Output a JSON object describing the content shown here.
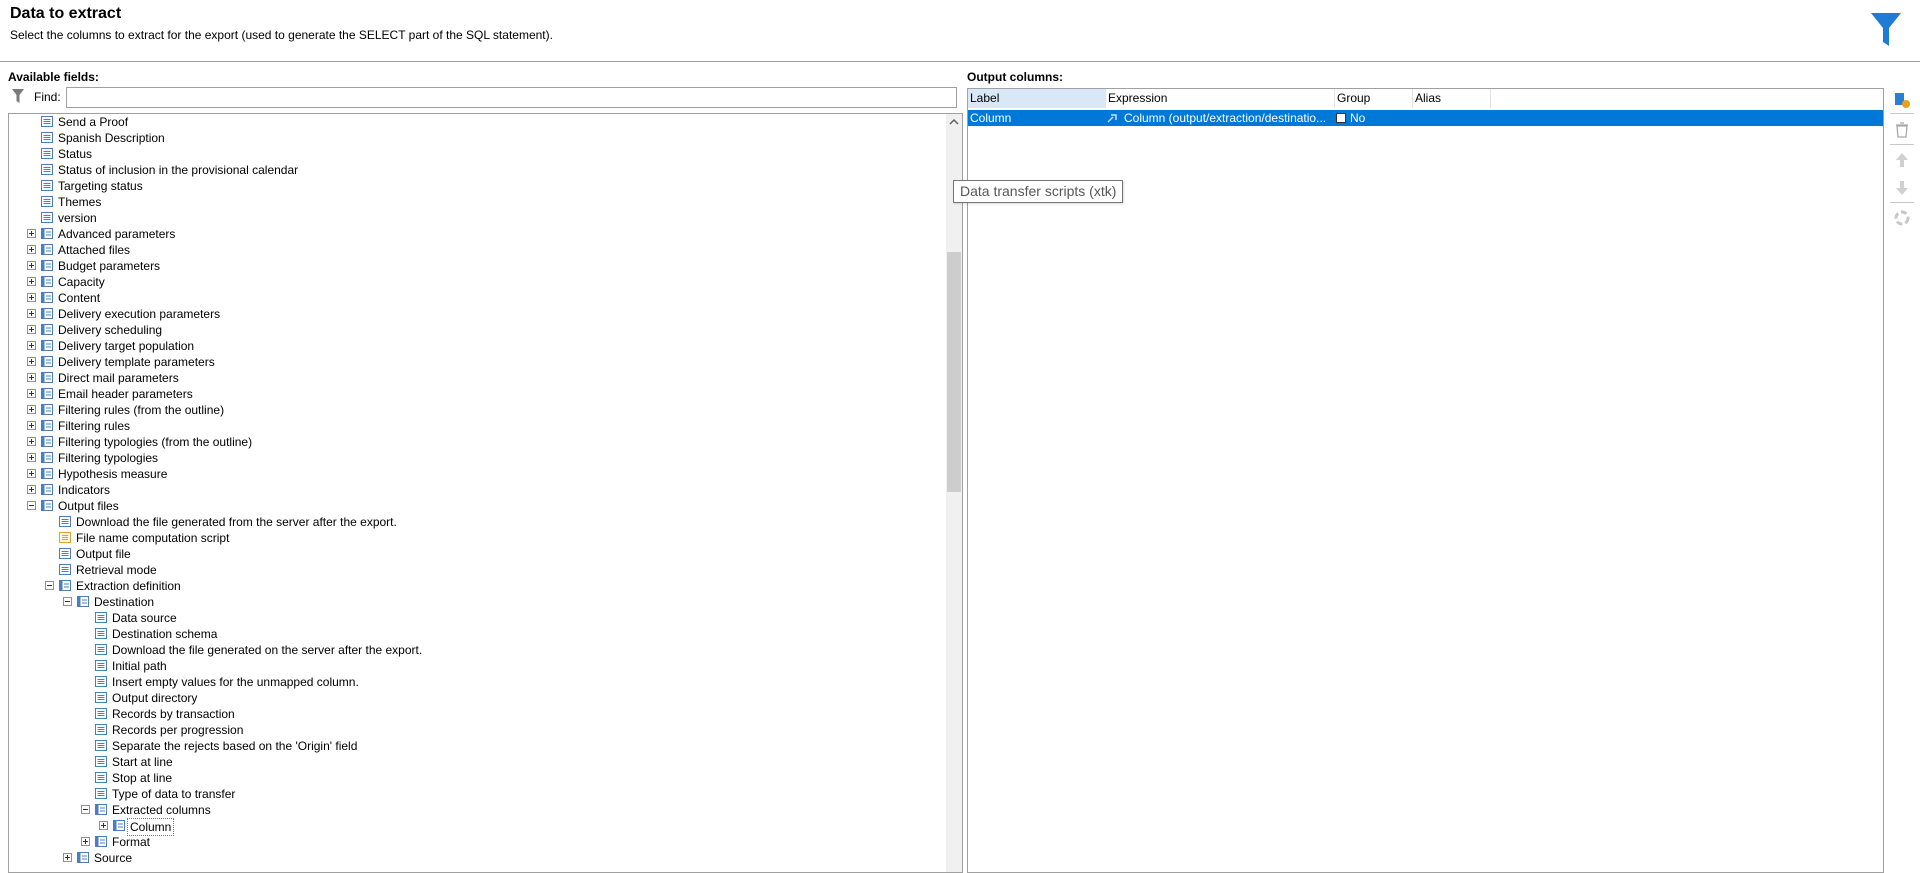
{
  "header": {
    "title": "Data to extract",
    "subtitle": "Select the columns to extract for the export (used to generate the SELECT part of the SQL statement)."
  },
  "left": {
    "label": "Available fields:",
    "find_label": "Find:",
    "find_value": ""
  },
  "tree": [
    {
      "label": "Send a Proof",
      "level": 1,
      "type": "field",
      "expander": "none"
    },
    {
      "label": "Spanish Description",
      "level": 1,
      "type": "field",
      "expander": "none"
    },
    {
      "label": "Status",
      "level": 1,
      "type": "field",
      "expander": "none"
    },
    {
      "label": "Status of inclusion in the provisional calendar",
      "level": 1,
      "type": "field",
      "expander": "none"
    },
    {
      "label": "Targeting status",
      "level": 1,
      "type": "field",
      "expander": "none"
    },
    {
      "label": "Themes",
      "level": 1,
      "type": "field",
      "expander": "none"
    },
    {
      "label": "version",
      "level": 1,
      "type": "field",
      "expander": "none"
    },
    {
      "label": "Advanced parameters",
      "level": 1,
      "type": "node",
      "expander": "plus"
    },
    {
      "label": "Attached files",
      "level": 1,
      "type": "node",
      "expander": "plus"
    },
    {
      "label": "Budget parameters",
      "level": 1,
      "type": "node",
      "expander": "plus"
    },
    {
      "label": "Capacity",
      "level": 1,
      "type": "node",
      "expander": "plus"
    },
    {
      "label": "Content",
      "level": 1,
      "type": "node",
      "expander": "plus"
    },
    {
      "label": "Delivery execution parameters",
      "level": 1,
      "type": "node",
      "expander": "plus"
    },
    {
      "label": "Delivery scheduling",
      "level": 1,
      "type": "node",
      "expander": "plus"
    },
    {
      "label": "Delivery target population",
      "level": 1,
      "type": "node",
      "expander": "plus"
    },
    {
      "label": "Delivery template parameters",
      "level": 1,
      "type": "node",
      "expander": "plus"
    },
    {
      "label": "Direct mail parameters",
      "level": 1,
      "type": "node",
      "expander": "plus"
    },
    {
      "label": "Email header parameters",
      "level": 1,
      "type": "node",
      "expander": "plus"
    },
    {
      "label": "Filtering rules (from the outline)",
      "level": 1,
      "type": "node",
      "expander": "plus"
    },
    {
      "label": "Filtering rules",
      "level": 1,
      "type": "node",
      "expander": "plus"
    },
    {
      "label": "Filtering typologies (from the outline)",
      "level": 1,
      "type": "node",
      "expander": "plus"
    },
    {
      "label": "Filtering typologies",
      "level": 1,
      "type": "node",
      "expander": "plus"
    },
    {
      "label": "Hypothesis measure",
      "level": 1,
      "type": "node",
      "expander": "plus"
    },
    {
      "label": "Indicators",
      "level": 1,
      "type": "node",
      "expander": "plus"
    },
    {
      "label": "Output files",
      "level": 1,
      "type": "node",
      "expander": "minus"
    },
    {
      "label": "Download the file generated from the server after the export.",
      "level": 2,
      "type": "field",
      "expander": "none"
    },
    {
      "label": "File name computation script",
      "level": 2,
      "type": "script",
      "expander": "none"
    },
    {
      "label": "Output file",
      "level": 2,
      "type": "field",
      "expander": "none"
    },
    {
      "label": "Retrieval mode",
      "level": 2,
      "type": "field",
      "expander": "none"
    },
    {
      "label": "Extraction definition",
      "level": 2,
      "type": "node",
      "expander": "minus"
    },
    {
      "label": "Destination",
      "level": 3,
      "type": "node",
      "expander": "minus"
    },
    {
      "label": "Data source",
      "level": 4,
      "type": "field",
      "expander": "none"
    },
    {
      "label": "Destination schema",
      "level": 4,
      "type": "field",
      "expander": "none"
    },
    {
      "label": "Download the file generated on the server after the export.",
      "level": 4,
      "type": "field",
      "expander": "none"
    },
    {
      "label": "Initial path",
      "level": 4,
      "type": "field",
      "expander": "none"
    },
    {
      "label": "Insert empty values for the unmapped column.",
      "level": 4,
      "type": "field",
      "expander": "none"
    },
    {
      "label": "Output directory",
      "level": 4,
      "type": "field",
      "expander": "none"
    },
    {
      "label": "Records by transaction",
      "level": 4,
      "type": "field",
      "expander": "none"
    },
    {
      "label": "Records per progression",
      "level": 4,
      "type": "field",
      "expander": "none"
    },
    {
      "label": "Separate the rejects based on the 'Origin' field",
      "level": 4,
      "type": "field",
      "expander": "none"
    },
    {
      "label": "Start at line",
      "level": 4,
      "type": "field",
      "expander": "none"
    },
    {
      "label": "Stop at line",
      "level": 4,
      "type": "field",
      "expander": "none"
    },
    {
      "label": "Type of data to transfer",
      "level": 4,
      "type": "field",
      "expander": "none"
    },
    {
      "label": "Extracted columns",
      "level": 4,
      "type": "node",
      "expander": "minus"
    },
    {
      "label": "Column",
      "level": 5,
      "type": "node",
      "expander": "plus",
      "selected": true
    },
    {
      "label": "Format",
      "level": 4,
      "type": "node",
      "expander": "plus"
    },
    {
      "label": "Source",
      "level": 3,
      "type": "node",
      "expander": "plus"
    }
  ],
  "right": {
    "label": "Output columns:",
    "columns": [
      "Label",
      "Expression",
      "Group",
      "Alias"
    ],
    "rows": [
      {
        "label": "Column",
        "expression": "Column (output/extraction/destinatio...",
        "group": "No",
        "alias": ""
      }
    ]
  },
  "tooltip": "Data transfer scripts (xtk)",
  "colors": {
    "accent": "#0078d7",
    "funnel": "#1e7bd6"
  },
  "toolbar_icons": [
    "add-expression-icon",
    "delete-icon",
    "move-up-icon",
    "move-down-icon",
    "distribution-icon"
  ]
}
